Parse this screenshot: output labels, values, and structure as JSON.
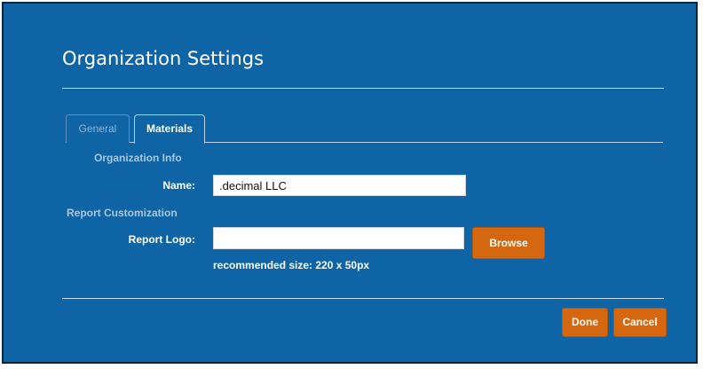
{
  "dialog": {
    "title": "Organization Settings"
  },
  "tabs": [
    {
      "label": "General",
      "active": false
    },
    {
      "label": "Materials",
      "active": true
    }
  ],
  "organization_info": {
    "section_label": "Organization Info",
    "name_label": "Name:",
    "name_value": ".decimal LLC"
  },
  "report_customization": {
    "section_label": "Report Customization",
    "logo_label": "Report Logo:",
    "logo_value": "",
    "browse_label": "Browse",
    "hint": "recommended size: 220 x 50px"
  },
  "footer": {
    "done_label": "Done",
    "cancel_label": "Cancel"
  },
  "colors": {
    "dialog_background": "#0e64a4",
    "button_accent": "#d4670f",
    "section_label": "#a8c7e3"
  }
}
